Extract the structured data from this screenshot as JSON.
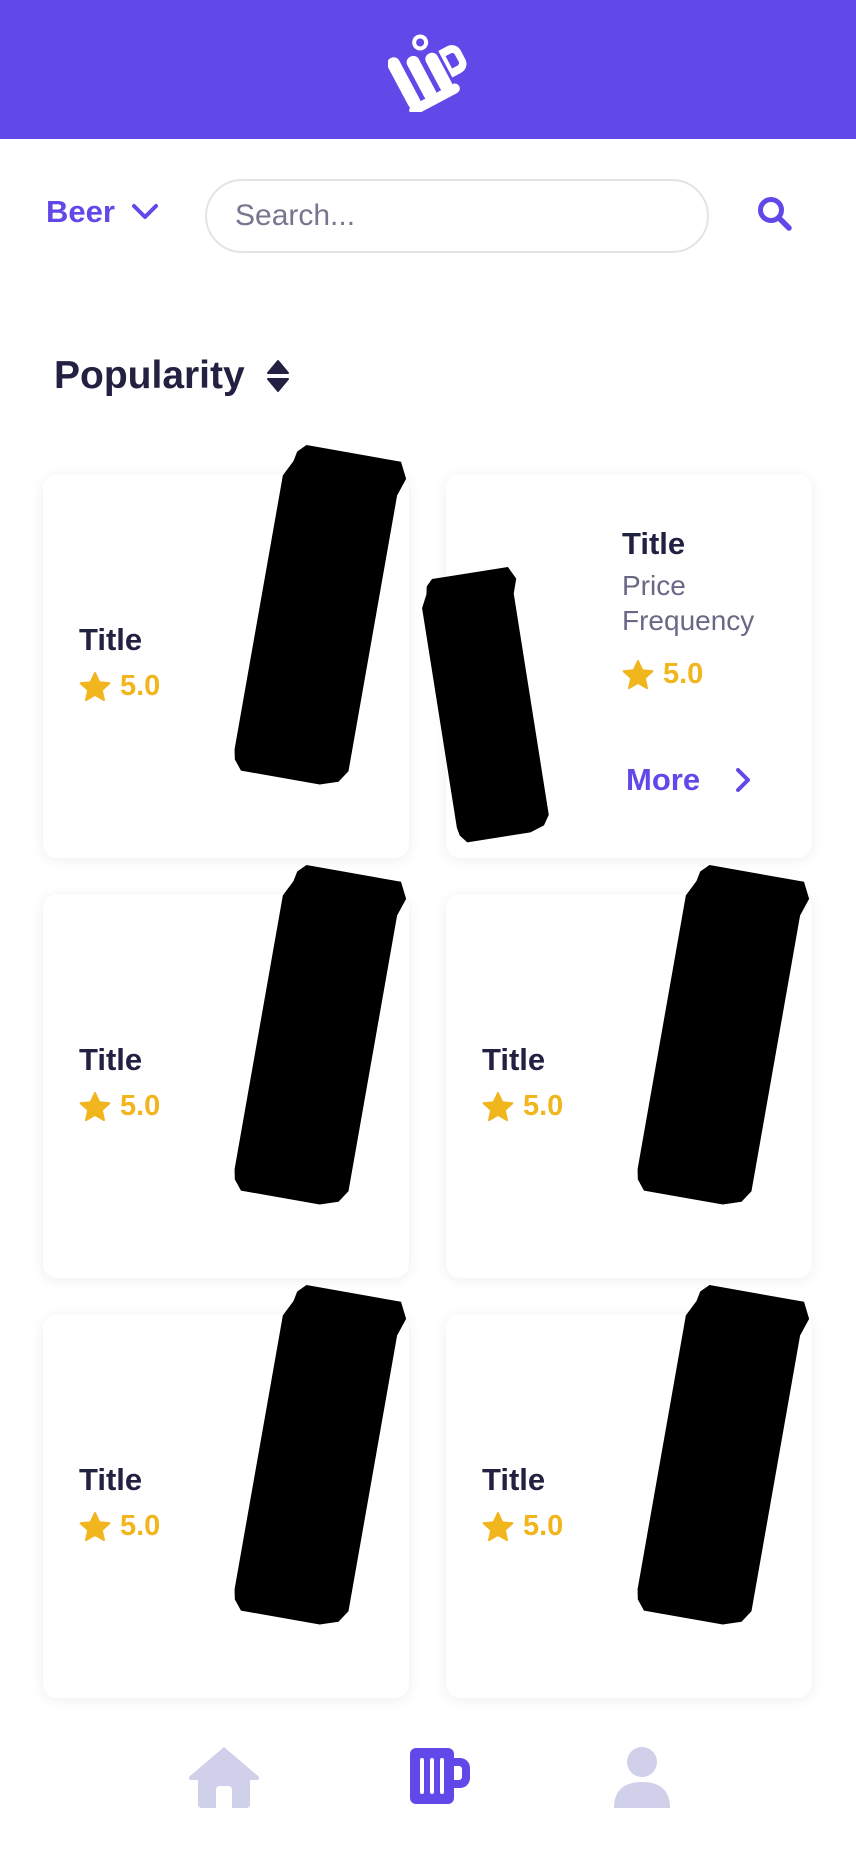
{
  "header": {
    "logo_icon": "bar-logo-icon"
  },
  "category": {
    "label": "Beer",
    "icon": "chevron-down-icon"
  },
  "search": {
    "placeholder": "Search...",
    "value": "",
    "icon": "search-icon"
  },
  "sort": {
    "label": "Popularity",
    "icon": "sort-icon"
  },
  "cards": [
    {
      "title": "Title",
      "rating": "5.0"
    },
    {
      "title": "Title",
      "price": "Price",
      "frequency": "Frequency",
      "rating": "5.0",
      "more_label": "More"
    },
    {
      "title": "Title",
      "rating": "5.0"
    },
    {
      "title": "Title",
      "rating": "5.0"
    },
    {
      "title": "Title",
      "rating": "5.0"
    },
    {
      "title": "Title",
      "rating": "5.0"
    }
  ],
  "nav": {
    "items": [
      {
        "icon": "home-icon",
        "active": false
      },
      {
        "icon": "beer-mug-icon",
        "active": true
      },
      {
        "icon": "user-icon",
        "active": false
      }
    ]
  },
  "colors": {
    "accent": "#6148e8",
    "rating": "#f1b51d",
    "placeholder_can": "#d1d0ea",
    "inactive_nav": "#d1d0ea"
  }
}
